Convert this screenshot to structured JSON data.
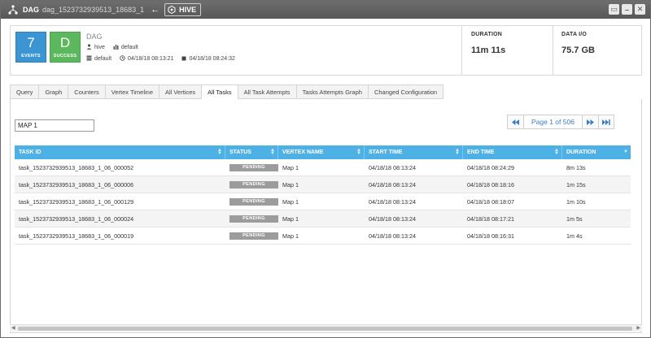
{
  "titlebar": {
    "label": "DAG",
    "dag_id": "dag_1523732939513_18683_1",
    "arrow": "←",
    "engine": "HIVE",
    "icons": [
      "dag-tree-icon",
      "hive-hexagon-icon",
      "window-icon",
      "minimize-icon",
      "close-icon"
    ]
  },
  "summary": {
    "events_count": "7",
    "events_label": "EVENTS",
    "status_letter": "D",
    "status_label": "SUCCESS",
    "dag_name": "DAG",
    "user": "hive",
    "queue": "default",
    "queue2": "default",
    "start_time": "04/18/18 08:13:21",
    "end_time": "04/18/18 08:24:32",
    "duration_label": "DURATION",
    "duration_value": "11m 11s",
    "data_io_label": "DATA I/O",
    "data_io_value": "75.7 GB"
  },
  "tabs": [
    {
      "label": "Query"
    },
    {
      "label": "Graph"
    },
    {
      "label": "Counters"
    },
    {
      "label": "Vertex Timeline"
    },
    {
      "label": "All Vertices"
    },
    {
      "label": "All Tasks"
    },
    {
      "label": "All Task Attempts"
    },
    {
      "label": "Tasks Attempts Graph"
    },
    {
      "label": "Changed Configuration"
    }
  ],
  "active_tab": "All Tasks",
  "search": {
    "value": "MAP 1"
  },
  "pager": {
    "label": "Page 1 of 506"
  },
  "table": {
    "columns": [
      "TASK ID",
      "STATUS",
      "VERTEX NAME",
      "START TIME",
      "END TIME",
      "DURATION"
    ],
    "rows": [
      [
        "task_1523732939513_18683_1_06_000052",
        "PENDING",
        "Map 1",
        "04/18/18 08:13:24",
        "04/18/18 08:24:29",
        "8m 13s"
      ],
      [
        "task_1523732939513_18683_1_06_000006",
        "PENDING",
        "Map 1",
        "04/18/18 08:13:24",
        "04/18/18 08:18:16",
        "1m 15s"
      ],
      [
        "task_1523732939513_18683_1_06_000129",
        "PENDING",
        "Map 1",
        "04/18/18 08:13:24",
        "04/18/18 08:18:07",
        "1m 10s"
      ],
      [
        "task_1523732939513_18683_1_06_000024",
        "PENDING",
        "Map 1",
        "04/18/18 08:13:24",
        "04/18/18 08:17:21",
        "1m 5s"
      ],
      [
        "task_1523732939513_18683_1_06_000019",
        "PENDING",
        "Map 1",
        "04/18/18 08:13:24",
        "04/18/18 08:16:31",
        "1m 4s"
      ]
    ]
  },
  "colors": {
    "titlebar": "#5f5f5f",
    "events_badge": "#3a95d2",
    "success_badge": "#5cb85c",
    "table_header": "#4db1e5",
    "status_pending": "#9c9c9c",
    "pager_accent": "#3a7cc0"
  }
}
